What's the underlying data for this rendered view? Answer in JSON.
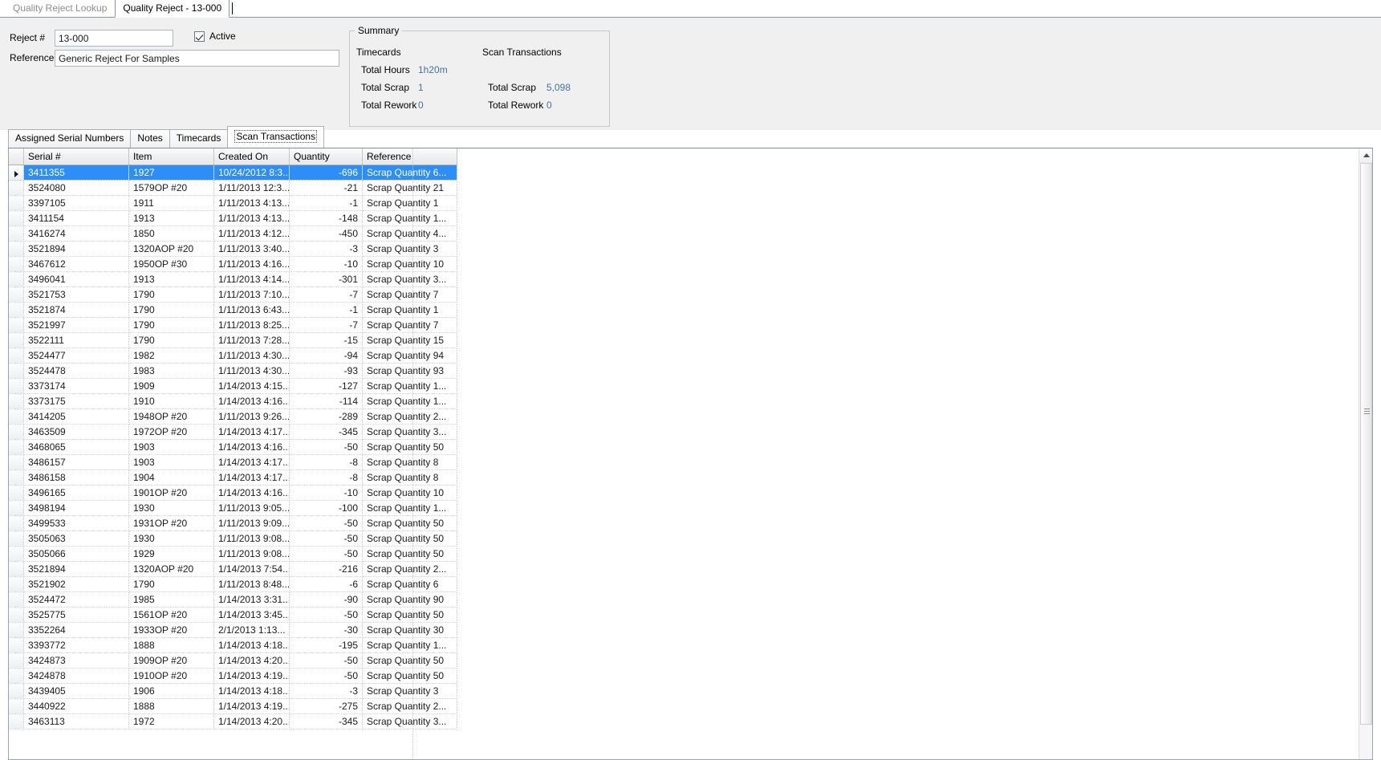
{
  "window": {
    "document_tabs": [
      {
        "label": "Quality Reject Lookup",
        "active": false
      },
      {
        "label": "Quality Reject - 13-000",
        "active": true
      }
    ]
  },
  "form": {
    "reject_number_label": "Reject #",
    "reject_number_value": "13-000",
    "reference_label": "Reference",
    "reference_value": "Generic Reject For Samples",
    "active_label": "Active",
    "active_checked": true
  },
  "summary": {
    "title": "Summary",
    "timecards_header": "Timecards",
    "scan_transactions_header": "Scan Transactions",
    "timecards": {
      "total_hours_label": "Total Hours",
      "total_hours_value": "1h20m",
      "total_scrap_label": "Total Scrap",
      "total_scrap_value": "1",
      "total_rework_label": "Total Rework",
      "total_rework_value": "0"
    },
    "scan_transactions": {
      "total_scrap_label": "Total Scrap",
      "total_scrap_value": "5,098",
      "total_rework_label": "Total Rework",
      "total_rework_value": "0"
    },
    "value_color": "#4a6fa5"
  },
  "tabs": [
    {
      "label": "Assigned Serial Numbers",
      "selected": false
    },
    {
      "label": "Notes",
      "selected": false
    },
    {
      "label": "Timecards",
      "selected": false
    },
    {
      "label": "Scan Transactions",
      "selected": true
    }
  ],
  "grid": {
    "columns": [
      "Serial #",
      "Item",
      "Created On",
      "Quantity",
      "Reference"
    ],
    "selection_color": "#2e8ef7",
    "selected_row_index": 0,
    "rows": [
      {
        "serial": "3411355",
        "item": "1927",
        "created": "10/24/2012 8:3...",
        "qty": "-696",
        "ref": "Scrap Quantity 6..."
      },
      {
        "serial": "3524080",
        "item": "1579OP #20",
        "created": "1/11/2013 12:3...",
        "qty": "-21",
        "ref": "Scrap Quantity 21"
      },
      {
        "serial": "3397105",
        "item": "1911",
        "created": "1/11/2013 4:13...",
        "qty": "-1",
        "ref": "Scrap Quantity 1"
      },
      {
        "serial": "3411154",
        "item": "1913",
        "created": "1/11/2013 4:13...",
        "qty": "-148",
        "ref": "Scrap Quantity 1..."
      },
      {
        "serial": "3416274",
        "item": "1850",
        "created": "1/11/2013 4:12...",
        "qty": "-450",
        "ref": "Scrap Quantity 4..."
      },
      {
        "serial": "3521894",
        "item": "1320AOP #20",
        "created": "1/11/2013 3:40...",
        "qty": "-3",
        "ref": "Scrap Quantity 3"
      },
      {
        "serial": "3467612",
        "item": "1950OP #30",
        "created": "1/11/2013 4:16...",
        "qty": "-10",
        "ref": "Scrap Quantity 10"
      },
      {
        "serial": "3496041",
        "item": "1913",
        "created": "1/11/2013 4:14...",
        "qty": "-301",
        "ref": "Scrap Quantity 3..."
      },
      {
        "serial": "3521753",
        "item": "1790",
        "created": "1/11/2013 7:10...",
        "qty": "-7",
        "ref": "Scrap Quantity 7"
      },
      {
        "serial": "3521874",
        "item": "1790",
        "created": "1/11/2013 6:43...",
        "qty": "-1",
        "ref": "Scrap Quantity 1"
      },
      {
        "serial": "3521997",
        "item": "1790",
        "created": "1/11/2013 8:25...",
        "qty": "-7",
        "ref": "Scrap Quantity 7"
      },
      {
        "serial": "3522111",
        "item": "1790",
        "created": "1/11/2013 7:28...",
        "qty": "-15",
        "ref": "Scrap Quantity 15"
      },
      {
        "serial": "3524477",
        "item": "1982",
        "created": "1/11/2013 4:30...",
        "qty": "-94",
        "ref": "Scrap Quantity 94"
      },
      {
        "serial": "3524478",
        "item": "1983",
        "created": "1/11/2013 4:30...",
        "qty": "-93",
        "ref": "Scrap Quantity 93"
      },
      {
        "serial": "3373174",
        "item": "1909",
        "created": "1/14/2013 4:15...",
        "qty": "-127",
        "ref": "Scrap Quantity 1..."
      },
      {
        "serial": "3373175",
        "item": "1910",
        "created": "1/14/2013 4:16...",
        "qty": "-114",
        "ref": "Scrap Quantity 1..."
      },
      {
        "serial": "3414205",
        "item": "1948OP #20",
        "created": "1/11/2013 9:26...",
        "qty": "-289",
        "ref": "Scrap Quantity 2..."
      },
      {
        "serial": "3463509",
        "item": "1972OP #20",
        "created": "1/14/2013 4:17...",
        "qty": "-345",
        "ref": "Scrap Quantity 3..."
      },
      {
        "serial": "3468065",
        "item": "1903",
        "created": "1/14/2013 4:16...",
        "qty": "-50",
        "ref": "Scrap Quantity 50"
      },
      {
        "serial": "3486157",
        "item": "1903",
        "created": "1/14/2013 4:17...",
        "qty": "-8",
        "ref": "Scrap Quantity 8"
      },
      {
        "serial": "3486158",
        "item": "1904",
        "created": "1/14/2013 4:17...",
        "qty": "-8",
        "ref": "Scrap Quantity 8"
      },
      {
        "serial": "3496165",
        "item": "1901OP #20",
        "created": "1/14/2013 4:16...",
        "qty": "-10",
        "ref": "Scrap Quantity 10"
      },
      {
        "serial": "3498194",
        "item": "1930",
        "created": "1/11/2013 9:05...",
        "qty": "-100",
        "ref": "Scrap Quantity 1..."
      },
      {
        "serial": "3499533",
        "item": "1931OP #20",
        "created": "1/11/2013 9:09...",
        "qty": "-50",
        "ref": "Scrap Quantity 50"
      },
      {
        "serial": "3505063",
        "item": "1930",
        "created": "1/11/2013 9:08...",
        "qty": "-50",
        "ref": "Scrap Quantity 50"
      },
      {
        "serial": "3505066",
        "item": "1929",
        "created": "1/11/2013 9:08...",
        "qty": "-50",
        "ref": "Scrap Quantity 50"
      },
      {
        "serial": "3521894",
        "item": "1320AOP #20",
        "created": "1/14/2013 7:54...",
        "qty": "-216",
        "ref": "Scrap Quantity 2..."
      },
      {
        "serial": "3521902",
        "item": "1790",
        "created": "1/11/2013 8:48...",
        "qty": "-6",
        "ref": "Scrap Quantity 6"
      },
      {
        "serial": "3524472",
        "item": "1985",
        "created": "1/14/2013 3:31...",
        "qty": "-90",
        "ref": "Scrap Quantity 90"
      },
      {
        "serial": "3525775",
        "item": "1561OP #20",
        "created": "1/14/2013 3:45...",
        "qty": "-50",
        "ref": "Scrap Quantity 50"
      },
      {
        "serial": "3352264",
        "item": "1933OP #20",
        "created": "2/1/2013 1:13...",
        "qty": "-30",
        "ref": "Scrap Quantity 30"
      },
      {
        "serial": "3393772",
        "item": "1888",
        "created": "1/14/2013 4:18...",
        "qty": "-195",
        "ref": "Scrap Quantity 1..."
      },
      {
        "serial": "3424873",
        "item": "1909OP #20",
        "created": "1/14/2013 4:20...",
        "qty": "-50",
        "ref": "Scrap Quantity 50"
      },
      {
        "serial": "3424878",
        "item": "1910OP #20",
        "created": "1/14/2013 4:19...",
        "qty": "-50",
        "ref": "Scrap Quantity 50"
      },
      {
        "serial": "3439405",
        "item": "1906",
        "created": "1/14/2013 4:18...",
        "qty": "-3",
        "ref": "Scrap Quantity 3"
      },
      {
        "serial": "3440922",
        "item": "1888",
        "created": "1/14/2013 4:19...",
        "qty": "-275",
        "ref": "Scrap Quantity 2..."
      },
      {
        "serial": "3463113",
        "item": "1972",
        "created": "1/14/2013 4:20...",
        "qty": "-345",
        "ref": "Scrap Quantity 3..."
      }
    ]
  }
}
